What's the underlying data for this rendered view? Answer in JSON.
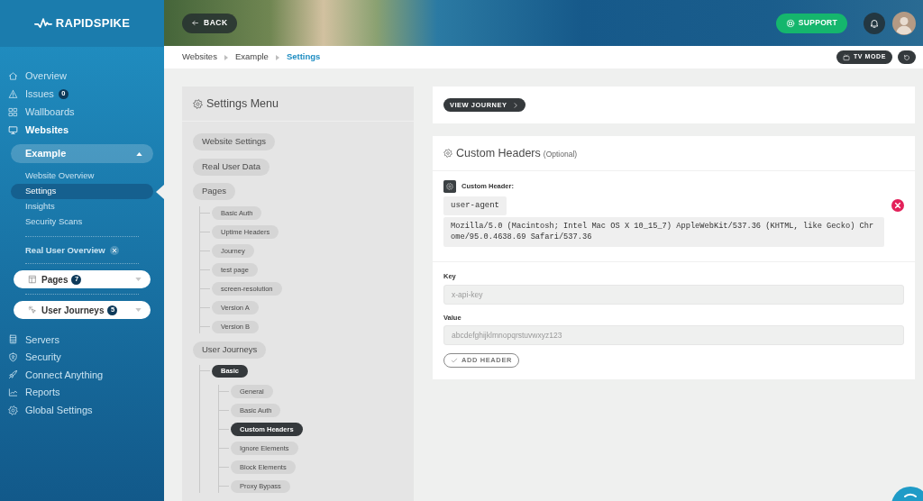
{
  "sidebar": {
    "logo": "RAPIDSPIKE",
    "nav": [
      {
        "label": "Overview",
        "selected": false
      },
      {
        "label": "Issues",
        "selected": false,
        "badge": "0"
      },
      {
        "label": "Wallboards",
        "selected": false
      },
      {
        "label": "Websites",
        "selected": true
      }
    ],
    "website": {
      "label": "Example",
      "expanded": true,
      "items": [
        {
          "label": "Website Overview",
          "selected": false
        },
        {
          "label": "Settings",
          "selected": true
        },
        {
          "label": "Insights",
          "selected": false
        },
        {
          "label": "Security Scans",
          "selected": false
        }
      ],
      "real_user": "Real User Overview",
      "groups": [
        {
          "label": "Pages",
          "count": "7",
          "expanded": false
        },
        {
          "label": "User Journeys",
          "count": "5",
          "expanded": false
        }
      ]
    },
    "nav_bottom": [
      {
        "label": "Servers",
        "selected": false
      },
      {
        "label": "Security",
        "selected": false
      },
      {
        "label": "Connect Anything",
        "selected": false
      },
      {
        "label": "Reports",
        "selected": false
      },
      {
        "label": "Global Settings",
        "selected": false
      }
    ]
  },
  "header": {
    "back": "BACK",
    "support": "SUPPORT"
  },
  "breadcrumb": [
    {
      "label": "Websites",
      "current": false
    },
    {
      "label": "Example",
      "current": false
    },
    {
      "label": "Settings",
      "current": true
    }
  ],
  "toolbar": {
    "tv_mode": "TV MODE"
  },
  "settings_menu": {
    "title": "Settings Menu",
    "items": [
      {
        "label": "Website Settings",
        "selected": false
      },
      {
        "label": "Real User Data",
        "selected": false
      },
      {
        "label": "Pages",
        "selected": false,
        "children": [
          {
            "label": "Basic Auth",
            "selected": false
          },
          {
            "label": "Uptime Headers",
            "selected": false
          },
          {
            "label": "Journey",
            "selected": false
          },
          {
            "label": "test page",
            "selected": false
          },
          {
            "label": "screen-resolution",
            "selected": false
          },
          {
            "label": "Version A",
            "selected": false
          },
          {
            "label": "Version B",
            "selected": false
          }
        ]
      },
      {
        "label": "User Journeys",
        "selected": false,
        "children": [
          {
            "label": "Basic",
            "selected": true,
            "children": [
              {
                "label": "General",
                "selected": false
              },
              {
                "label": "Basic Auth",
                "selected": false
              },
              {
                "label": "Custom Headers",
                "selected": true
              },
              {
                "label": "Ignore Elements",
                "selected": false
              },
              {
                "label": "Block Elements",
                "selected": false
              },
              {
                "label": "Proxy Bypass",
                "selected": false
              }
            ]
          }
        ]
      }
    ]
  },
  "journey": {
    "button": "VIEW JOURNEY"
  },
  "custom_headers": {
    "title": "Custom Headers",
    "note": "(Optional)",
    "headers": [
      {
        "label": "Custom Header:",
        "key": "user-agent",
        "value": "Mozilla/5.0 (Macintosh; Intel Mac OS X 10_15_7) AppleWebKit/537.36 (KHTML, like Gecko) Chrome/95.0.4638.69 Safari/537.36"
      }
    ],
    "fields": [
      {
        "label": "Key",
        "placeholder": "x-api-key"
      },
      {
        "label": "Value",
        "placeholder": "abcdefghijklmnopqrstuvwxyz123"
      }
    ],
    "add_button": "ADD HEADER"
  }
}
